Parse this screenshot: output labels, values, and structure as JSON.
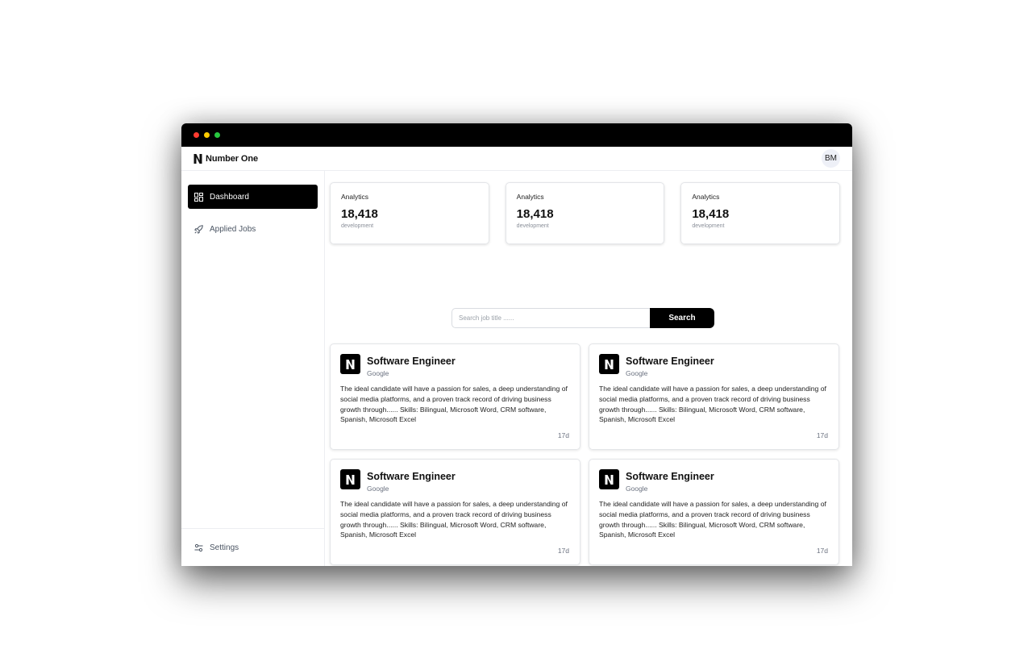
{
  "colors": {
    "titlebar": "#000000",
    "close": "#ff3b30",
    "minimize": "#ffcc00",
    "maximize": "#28c840",
    "accent": "#000000"
  },
  "header": {
    "brand": "Number One",
    "avatar_initials": "BM"
  },
  "sidebar": {
    "items": [
      {
        "label": "Dashboard",
        "icon": "dashboard-grid-icon",
        "active": true
      },
      {
        "label": "Applied Jobs",
        "icon": "rocket-icon",
        "active": false
      }
    ],
    "settings_label": "Settings"
  },
  "stats": [
    {
      "label": "Analytics",
      "value": "18,418",
      "sub": "development"
    },
    {
      "label": "Analytics",
      "value": "18,418",
      "sub": "development"
    },
    {
      "label": "Analytics",
      "value": "18,418",
      "sub": "development"
    }
  ],
  "search": {
    "placeholder": "Search job title ......",
    "button_label": "Search"
  },
  "jobs": [
    {
      "title": "Software Engineer",
      "company": "Google",
      "description": "The ideal candidate will have a passion for sales, a deep understanding of social media platforms, and a proven track record of driving business growth through...... Skills: Bilingual, Microsoft Word, CRM software, Spanish, Microsoft Excel",
      "age": "17d"
    },
    {
      "title": "Software Engineer",
      "company": "Google",
      "description": "The ideal candidate will have a passion for sales, a deep understanding of social media platforms, and a proven track record of driving business growth through...... Skills: Bilingual, Microsoft Word, CRM software, Spanish, Microsoft Excel",
      "age": "17d"
    },
    {
      "title": "Software Engineer",
      "company": "Google",
      "description": "The ideal candidate will have a passion for sales, a deep understanding of social media platforms, and a proven track record of driving business growth through...... Skills: Bilingual, Microsoft Word, CRM software, Spanish, Microsoft Excel",
      "age": "17d"
    },
    {
      "title": "Software Engineer",
      "company": "Google",
      "description": "The ideal candidate will have a passion for sales, a deep understanding of social media platforms, and a proven track record of driving business growth through...... Skills: Bilingual, Microsoft Word, CRM software, Spanish, Microsoft Excel",
      "age": "17d"
    }
  ]
}
